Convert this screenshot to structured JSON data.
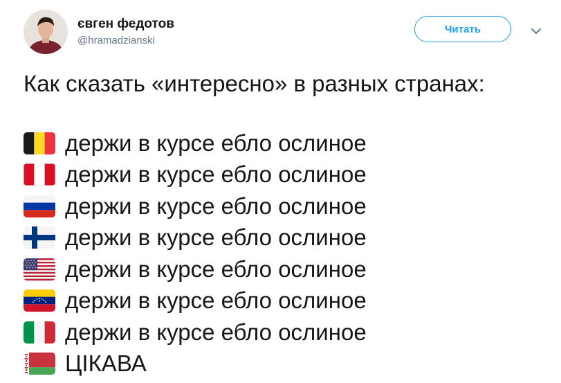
{
  "author": {
    "name": "євген федотов",
    "handle": "@hramadzianski"
  },
  "actions": {
    "follow_label": "Читать"
  },
  "tweet": {
    "intro": "Как сказать «интересно» в разных странах:",
    "lines": [
      {
        "flag": "belgium-flag-icon",
        "text": "держи в курсе ебло ослиное"
      },
      {
        "flag": "peru-flag-icon",
        "text": "держи в курсе ебло ослиное"
      },
      {
        "flag": "russia-flag-icon",
        "text": "держи в курсе ебло ослиное"
      },
      {
        "flag": "finland-flag-icon",
        "text": "держи в курсе ебло ослиное"
      },
      {
        "flag": "usa-flag-icon",
        "text": "держи в курсе ебло ослиное"
      },
      {
        "flag": "venezuela-flag-icon",
        "text": "держи в курсе ебло ослиное"
      },
      {
        "flag": "italy-flag-icon",
        "text": "держи в курсе ебло ослиное"
      },
      {
        "flag": "belarus-flag-icon",
        "text": "ЦІКАВА"
      }
    ]
  },
  "colors": {
    "accent": "#1da1f2",
    "text": "#14171a",
    "secondary_text": "#657786"
  }
}
